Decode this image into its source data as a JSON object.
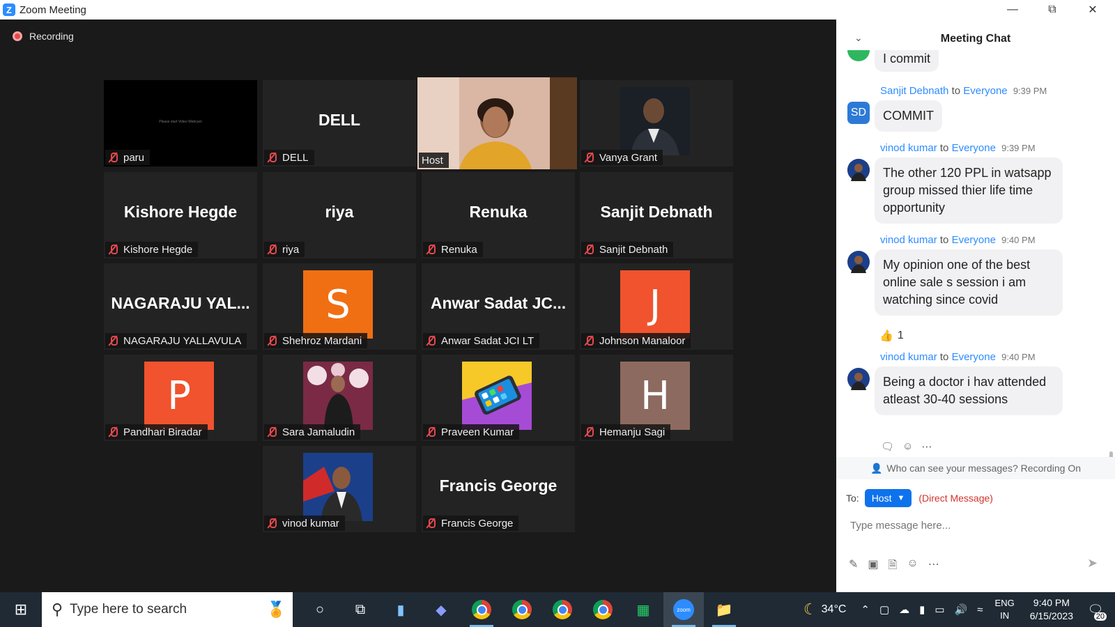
{
  "window": {
    "title": "Zoom Meeting",
    "icon": "zoom-logo"
  },
  "meeting": {
    "recording_label": "Recording",
    "tiles": [
      {
        "name": "paru",
        "display": "black-screen",
        "screen_text": "Please start Video Webcam",
        "active": false
      },
      {
        "name": "DELL",
        "display": "name",
        "big_label": "DELL",
        "active": false
      },
      {
        "name": "Host",
        "display": "video",
        "active": true,
        "border_color": "#b9f23b"
      },
      {
        "name": "Vanya Grant",
        "display": "photo",
        "active": false
      },
      {
        "name": "Kishore Hegde",
        "display": "name",
        "big_label": "Kishore Hegde"
      },
      {
        "name": "riya",
        "display": "name",
        "big_label": "riya"
      },
      {
        "name": "Renuka",
        "display": "name",
        "big_label": "Renuka"
      },
      {
        "name": "Sanjit Debnath",
        "display": "name",
        "big_label": "Sanjit Debnath"
      },
      {
        "name": "NAGARAJU YALLAVULA",
        "display": "name",
        "big_label": "NAGARAJU  YAL..."
      },
      {
        "name": "Shehroz Mardani",
        "display": "initial",
        "initial": "S",
        "color": "#f16f13"
      },
      {
        "name": "Anwar Sadat JCI LT",
        "display": "name",
        "big_label": "Anwar  Sadat  JC..."
      },
      {
        "name": "Johnson Manaloor",
        "display": "initial",
        "initial": "J",
        "color": "#f0532d"
      },
      {
        "name": "Pandhari Biradar",
        "display": "initial",
        "initial": "P",
        "color": "#f0532d"
      },
      {
        "name": "Sara Jamaludin",
        "display": "photo"
      },
      {
        "name": "Praveen Kumar",
        "display": "photo"
      },
      {
        "name": "Hemanju Sagi",
        "display": "initial",
        "initial": "H",
        "color": "#8d6a5f"
      },
      {
        "name": "vinod kumar",
        "display": "photo"
      },
      {
        "name": "Francis George",
        "display": "name",
        "big_label": "Francis George"
      }
    ]
  },
  "chat": {
    "title": "Meeting Chat",
    "partial_message": "I commit",
    "messages": [
      {
        "sender": "Sanjit Debnath",
        "to_word": "to",
        "recipient": "Everyone",
        "time": "9:39 PM",
        "avatar": "SD",
        "text": "COMMIT"
      },
      {
        "sender": "vinod kumar",
        "to_word": "to",
        "recipient": "Everyone",
        "time": "9:39 PM",
        "avatar": "photo",
        "text": "The other 120 PPL in watsapp group missed thier life time opportunity"
      },
      {
        "sender": "vinod kumar",
        "to_word": "to",
        "recipient": "Everyone",
        "time": "9:40 PM",
        "avatar": "photo",
        "text": "My opinion one of the best online sale s session i am watching since covid"
      },
      {
        "sender": "vinod kumar",
        "to_word": "to",
        "recipient": "Everyone",
        "time": "9:40 PM",
        "avatar": "photo",
        "text": "Being a doctor i hav attended atleast 30-40 sessions"
      }
    ],
    "reaction": {
      "emoji": "👍",
      "count": "1"
    },
    "privacy_notice": "Who can see your messages? Recording On",
    "to_label": "To:",
    "recipient_button": "Host",
    "direct_message_label": "(Direct Message)",
    "input_placeholder": "Type message here...",
    "colors": {
      "accent": "#0e72ed",
      "link": "#2d8cff",
      "dm": "#d0342c",
      "sd_avatar": "#2d7ad6"
    }
  },
  "taskbar": {
    "search_placeholder": "Type here to search",
    "weather_temp": "34°C",
    "language_top": "ENG",
    "language_bottom": "IN",
    "time": "9:40 PM",
    "date": "6/15/2023",
    "notification_count": "20"
  }
}
